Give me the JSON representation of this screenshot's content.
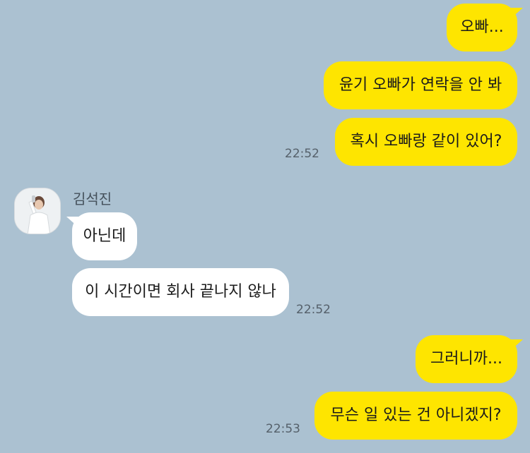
{
  "colors": {
    "background": "#abc1d1",
    "sent_bubble": "#fee500",
    "received_bubble": "#ffffff",
    "timestamp_text": "#55606a"
  },
  "messages": [
    {
      "sender": "me",
      "text": "오빠..."
    },
    {
      "sender": "me",
      "text": "윤기 오빠가 연락을 안 봐"
    },
    {
      "sender": "me",
      "text": "혹시 오빠랑 같이 있어?",
      "time": "22:52"
    },
    {
      "sender": "김석진",
      "text": "아닌데"
    },
    {
      "sender": "김석진",
      "text": "이 시간이면 회사 끝나지 않나",
      "time": "22:52"
    },
    {
      "sender": "me",
      "text": "그러니까..."
    },
    {
      "sender": "me",
      "text": "무슨 일 있는 건 아니겠지?",
      "time": "22:53"
    }
  ],
  "contact": {
    "name": "김석진",
    "avatar_icon": "profile-photo-avatar"
  }
}
